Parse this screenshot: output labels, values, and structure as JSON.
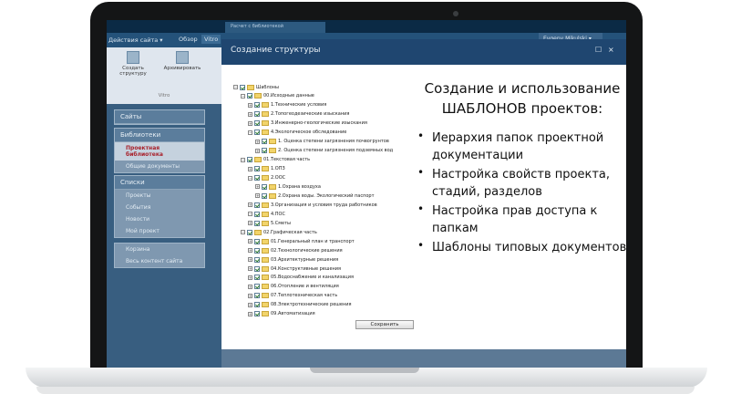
{
  "sharepoint": {
    "top_tab": "Расчет с библиотекой",
    "actions_menu": "Действия сайта ▾",
    "tab_browse": "Обзор",
    "tab_active": "Vitro",
    "user": "Evgeny Mikulski ▾",
    "ribbon": {
      "btn_create": "Создать структуру",
      "btn_archive": "Архивировать",
      "group": "Vitro"
    },
    "nav": {
      "sites": "Сайты",
      "libraries": "Библиотеки",
      "project_library": "Проектная библиотека",
      "shared_docs": "Общие документы",
      "lists": "Списки",
      "projects": "Проекты",
      "events": "События",
      "news": "Новости",
      "my_project": "Мой проект",
      "recycle": "Корзина",
      "all_content": "Весь контент сайта"
    }
  },
  "modal": {
    "title": "Создание структуры",
    "max_icon": "☐",
    "close_icon": "×",
    "save_button": "Сохранить"
  },
  "tree": [
    {
      "label": "Шаблоны",
      "level": 0
    },
    {
      "label": "00.Исходные данные",
      "level": 1
    },
    {
      "label": "1.Технические условия",
      "level": 2
    },
    {
      "label": "2.Топогеодезические изыскания",
      "level": 2
    },
    {
      "label": "3.Инженерно-геологические изыскания",
      "level": 2
    },
    {
      "label": "4.Экологическое обследование",
      "level": 2
    },
    {
      "label": "1. Оценка степени загрязнения почвогрунтов",
      "level": 3
    },
    {
      "label": "2. Оценка степени загрязнения подземных вод",
      "level": 3
    },
    {
      "label": "01.Текстовая часть",
      "level": 1
    },
    {
      "label": "1.ОПЗ",
      "level": 2
    },
    {
      "label": "2.ООС",
      "level": 2
    },
    {
      "label": "1.Охрана воздуха",
      "level": 3
    },
    {
      "label": "2.Охрана воды. Экологический паспорт",
      "level": 3
    },
    {
      "label": "3.Организация и условия труда работников",
      "level": 2
    },
    {
      "label": "4.ПОС",
      "level": 2
    },
    {
      "label": "5.Сметы",
      "level": 2
    },
    {
      "label": "02.Графическая часть",
      "level": 1
    },
    {
      "label": "01.Генеральный план и транспорт",
      "level": 2
    },
    {
      "label": "02.Технологические решения",
      "level": 2
    },
    {
      "label": "03.Архитектурные решения",
      "level": 2
    },
    {
      "label": "04.Конструктивные решения",
      "level": 2
    },
    {
      "label": "05.Водоснабжение и канализация",
      "level": 2
    },
    {
      "label": "06.Отопление и вентиляция",
      "level": 2
    },
    {
      "label": "07.Теплотехническая часть",
      "level": 2
    },
    {
      "label": "08.Электротехнические решения",
      "level": 2
    },
    {
      "label": "09.Автоматизация",
      "level": 2
    }
  ],
  "panel": {
    "heading_line1": "Создание и использование",
    "heading_line2": "ШАБЛОНОВ проектов:",
    "bullets": [
      {
        "line1": "Иерархия папок проектной",
        "line2": "документации"
      },
      {
        "line1": "Настройка свойств проекта,",
        "line2": "стадий, разделов"
      },
      {
        "line1": "Настройка прав доступа к",
        "line2": "папкам"
      },
      {
        "line1": "Шаблоны типовых документов",
        "line2": ""
      }
    ]
  }
}
